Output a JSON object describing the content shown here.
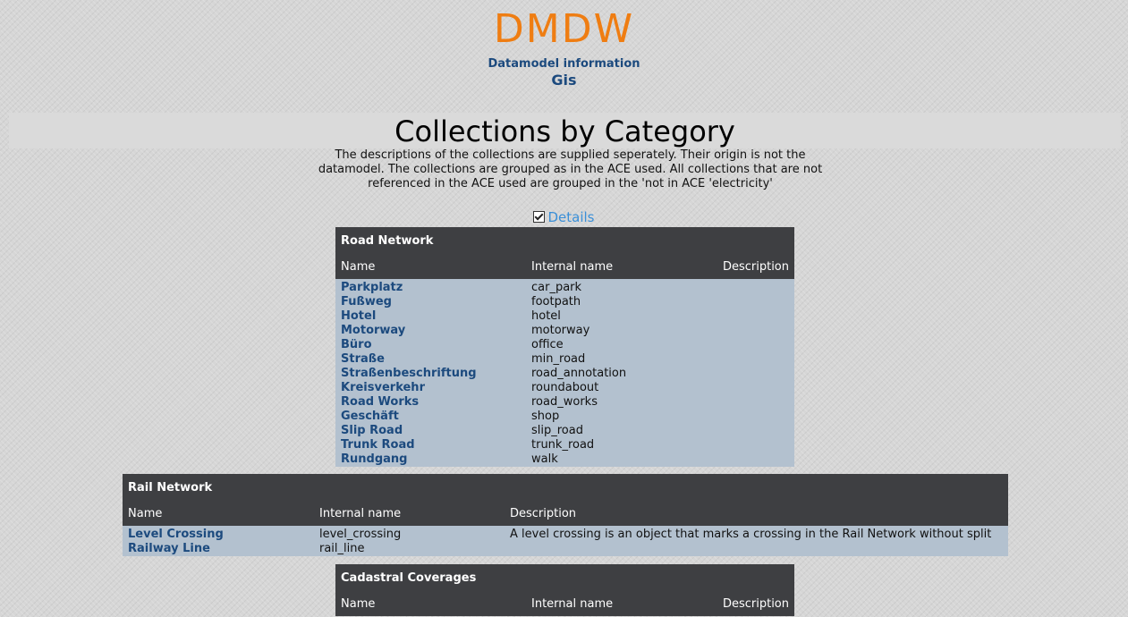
{
  "header": {
    "logo": "DMDW",
    "subtitle": "Datamodel information",
    "model": "Gis"
  },
  "page_title": "Collections by Category",
  "intro": "The descriptions of the collections are supplied seperately. Their origin is not the datamodel. The collections are grouped as in the ACE used. All collections that are not referenced in the ACE used are grouped in the 'not in ACE 'electricity'",
  "details": {
    "label": "Details",
    "checked": true
  },
  "columns": {
    "name": "Name",
    "internal": "Internal name",
    "description": "Description"
  },
  "categories": [
    {
      "title": "Road Network",
      "rows": [
        {
          "name": "Parkplatz",
          "internal": "car_park",
          "description": ""
        },
        {
          "name": "Fußweg",
          "internal": "footpath",
          "description": ""
        },
        {
          "name": "Hotel",
          "internal": "hotel",
          "description": ""
        },
        {
          "name": "Motorway",
          "internal": "motorway",
          "description": ""
        },
        {
          "name": "Büro",
          "internal": "office",
          "description": ""
        },
        {
          "name": "Straße",
          "internal": "min_road",
          "description": ""
        },
        {
          "name": "Straßenbeschriftung",
          "internal": "road_annotation",
          "description": ""
        },
        {
          "name": "Kreisverkehr",
          "internal": "roundabout",
          "description": ""
        },
        {
          "name": "Road Works",
          "internal": "road_works",
          "description": ""
        },
        {
          "name": "Geschäft",
          "internal": "shop",
          "description": ""
        },
        {
          "name": "Slip Road",
          "internal": "slip_road",
          "description": ""
        },
        {
          "name": "Trunk Road",
          "internal": "trunk_road",
          "description": ""
        },
        {
          "name": "Rundgang",
          "internal": "walk",
          "description": ""
        }
      ]
    },
    {
      "title": "Rail Network",
      "rows": [
        {
          "name": "Level Crossing",
          "internal": "level_crossing",
          "description": "A level crossing is an object that marks a crossing in the Rail Network without split"
        },
        {
          "name": "Railway Line",
          "internal": "rail_line",
          "description": ""
        }
      ]
    },
    {
      "title": "Cadastral Coverages",
      "rows": []
    }
  ],
  "colors": {
    "logo": "#ef7d12",
    "link": "#1c4a7e",
    "details_link": "#3a8fd8",
    "table_header": "#3e3f42",
    "table_row": "#b3c1cf"
  }
}
